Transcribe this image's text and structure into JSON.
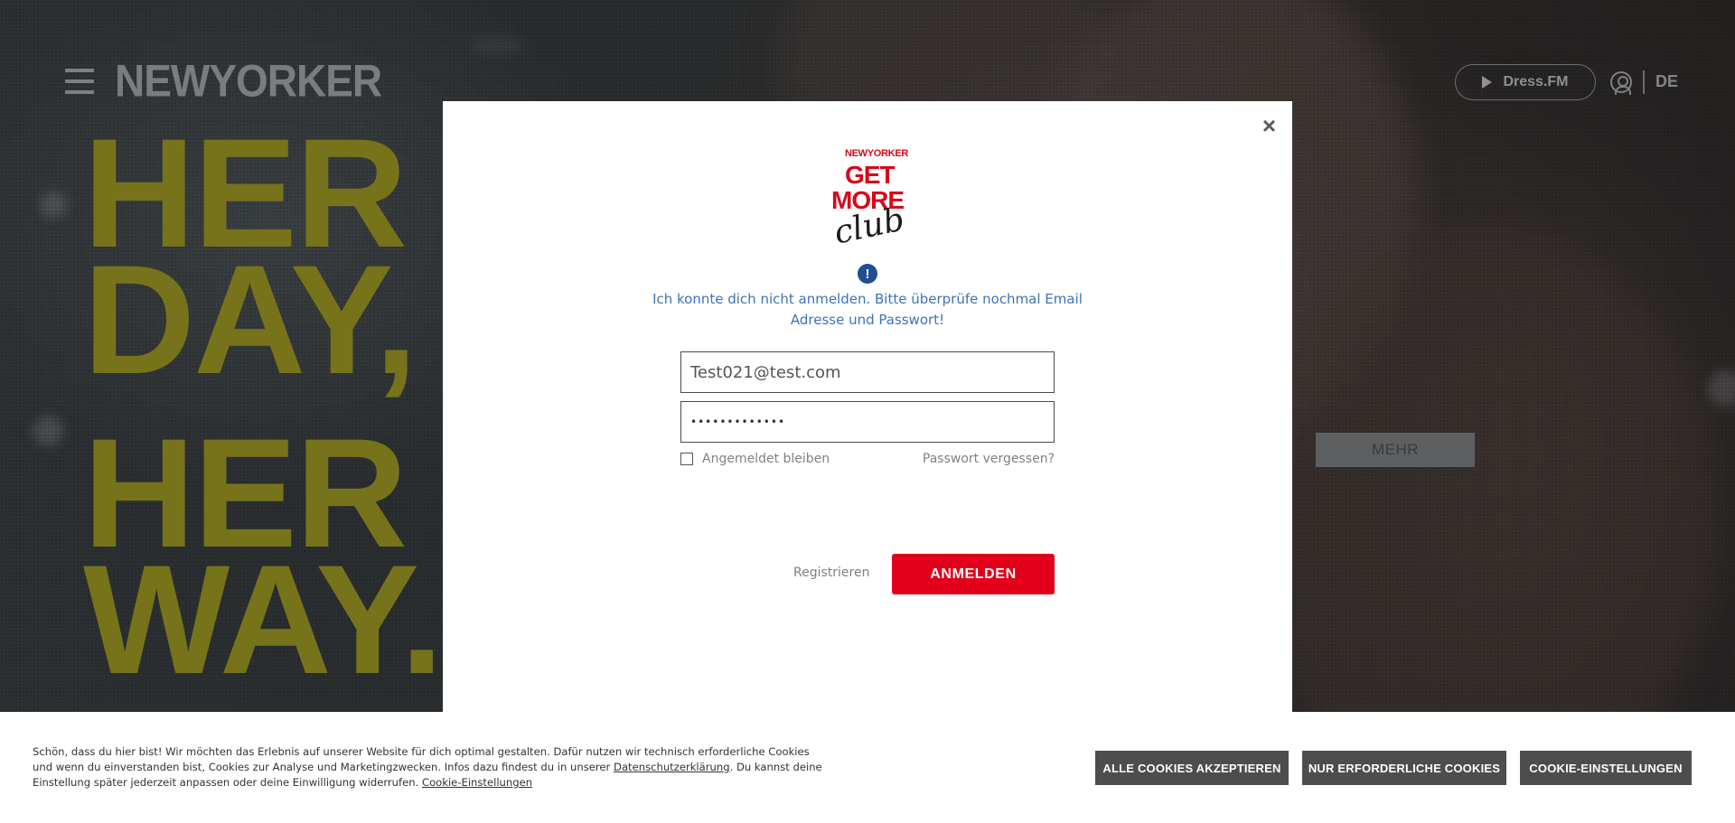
{
  "header": {
    "brand_main": "NEWYORKER",
    "dressfm_label": "Dress.FM",
    "language": "DE"
  },
  "hero": {
    "line1": "HER",
    "line2": "DAY,",
    "line3": "HER",
    "line4": "WAY.",
    "more_button": "MEHR"
  },
  "login_modal": {
    "close_label": "×",
    "logo": {
      "brand_small": "NEWYORKER",
      "line1": "GET",
      "line2": "MORE",
      "script": "club"
    },
    "error_icon": "!",
    "error_message": "Ich konnte dich nicht anmelden. Bitte überprüfe nochmal Email Adresse und Passwort!",
    "email_value": "Test021@test.com",
    "password_value": "•••••••••••••",
    "remember_label": "Angemeldet bleiben",
    "forgot_label": "Passwort vergessen?",
    "register_label": "Registrieren",
    "login_button": "ANMELDEN"
  },
  "cookie_banner": {
    "text_part1": "Schön, dass du hier bist! Wir möchten das Erlebnis auf unserer Website für dich optimal gestalten. Dafür nutzen wir technisch erforderliche Cookies und wenn du einverstanden bist, Cookies zur Analyse und Marketingzwecken. Infos dazu findest du in unserer ",
    "privacy_link": "Datenschutzerklärung",
    "text_part2": ". Du kannst deine Einstellung später jederzeit anpassen oder deine Einwilligung widerrufen. ",
    "settings_link": "Cookie-Einstellungen",
    "accept_all": "ALLE COOKIES AKZEPTIEREN",
    "necessary_only": "NUR ERFORDERLICHE COOKIES",
    "settings_button": "COOKIE-EINSTELLUNGEN"
  },
  "colors": {
    "accent_red": "#e2001a",
    "error_blue": "#3d73b8",
    "headline_yellow": "#77731a"
  },
  "icons": [
    "hamburger-menu-icon",
    "play-icon",
    "user-icon",
    "close-icon",
    "info-icon",
    "checkbox"
  ]
}
